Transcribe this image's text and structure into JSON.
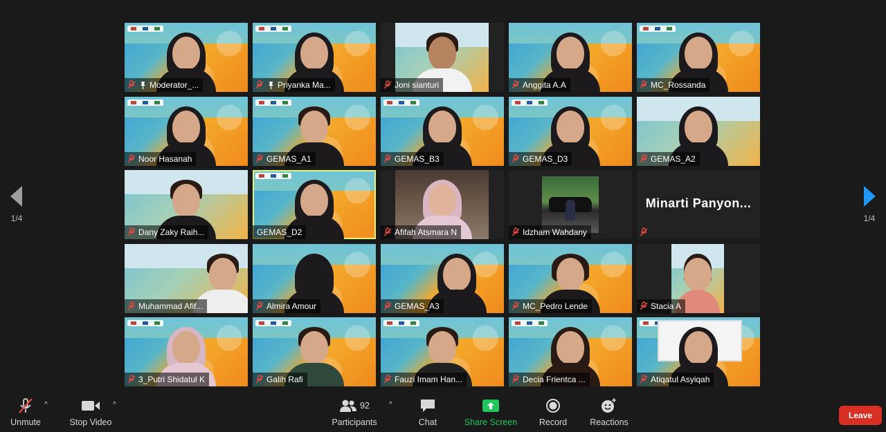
{
  "pager": {
    "left_label": "1/4",
    "right_label": "1/4"
  },
  "tiles": [
    {
      "name": "Moderator_...",
      "pinned": true
    },
    {
      "name": "Priyanka Ma...",
      "pinned": true
    },
    {
      "name": "Joni sianturi",
      "pinned": false
    },
    {
      "name": "Anggita A.A",
      "pinned": false
    },
    {
      "name": "MC_Rossanda",
      "pinned": false
    },
    {
      "name": "Noor Hasanah",
      "pinned": false
    },
    {
      "name": "GEMAS_A1",
      "pinned": false
    },
    {
      "name": "GEMAS_B3",
      "pinned": false
    },
    {
      "name": "GEMAS_D3",
      "pinned": false
    },
    {
      "name": "GEMAS_A2",
      "pinned": false
    },
    {
      "name": "Dany Zaky Raih...",
      "pinned": false
    },
    {
      "name": "GEMAS_D2",
      "pinned": false
    },
    {
      "name": "Afifah Atsmara N",
      "pinned": false
    },
    {
      "name": "Idzham Wahdany",
      "pinned": false
    },
    {
      "name": "",
      "big_name": "Minarti Panyon...",
      "pinned": false
    },
    {
      "name": "Muhammad Afif...",
      "pinned": false
    },
    {
      "name": "Almira Amour",
      "pinned": false
    },
    {
      "name": "GEMAS_A3",
      "pinned": false
    },
    {
      "name": "MC_Pedro Lende",
      "pinned": false
    },
    {
      "name": "Stacia A",
      "pinned": false
    },
    {
      "name": "3_Putri Shidatul K",
      "pinned": false
    },
    {
      "name": "Galih Rafi",
      "pinned": false
    },
    {
      "name": "Fauzi Imam Han...",
      "pinned": false
    },
    {
      "name": "Decia Frientca ...",
      "pinned": false
    },
    {
      "name": "Atiqatul Asyiqah",
      "pinned": false
    }
  ],
  "toolbar": {
    "unmute": "Unmute",
    "stop_video": "Stop Video",
    "participants": "Participants",
    "participants_count": "92",
    "chat": "Chat",
    "share_screen": "Share Screen",
    "record": "Record",
    "reactions": "Reactions",
    "leave": "Leave"
  },
  "colors": {
    "background": "#1a1a1a",
    "share_green": "#22c55e",
    "leave_red": "#d93025",
    "active_speaker": "#e3f57a",
    "pager_arrow_left": "#9e9e9e",
    "pager_arrow_right": "#2196f3",
    "mute_red": "#e5483e"
  }
}
